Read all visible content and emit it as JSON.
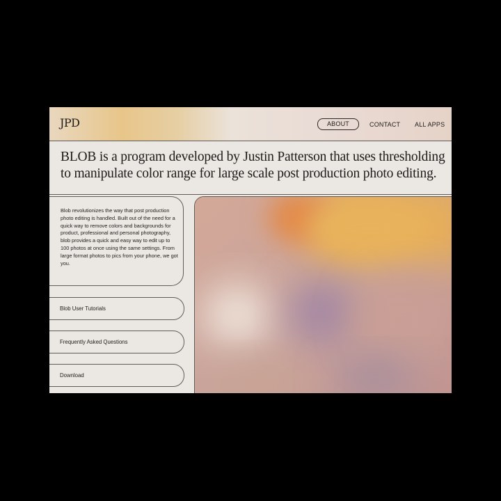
{
  "header": {
    "logo": "JPD",
    "nav": [
      {
        "label": "ABOUT",
        "active": true
      },
      {
        "label": "CONTACT",
        "active": false
      },
      {
        "label": "ALL APPS",
        "active": false
      }
    ]
  },
  "headline": "BLOB is a program developed by Justin Patterson that uses thresholding to manipulate color range for large scale post production photo editing.",
  "description": "Blob revolutionizes the way that post production photo editing is handled. Built out of the need for a quick way to remove colors and backgrounds for product, professional and personal photography, blob provides a quick and easy way to edit up to 100 photos at once using the same settings. From large format photos to pics from your phone, we got you.",
  "links": [
    {
      "label": "Blob User Tutorials"
    },
    {
      "label": "Frequently Asked Questions"
    },
    {
      "label": "Download"
    }
  ],
  "colors": {
    "page_bg": "#000000",
    "card_bg": "#ebe7e3",
    "accent_orange": "#e0a457",
    "accent_purple": "#a48aa0",
    "line": "#5f5a55"
  }
}
